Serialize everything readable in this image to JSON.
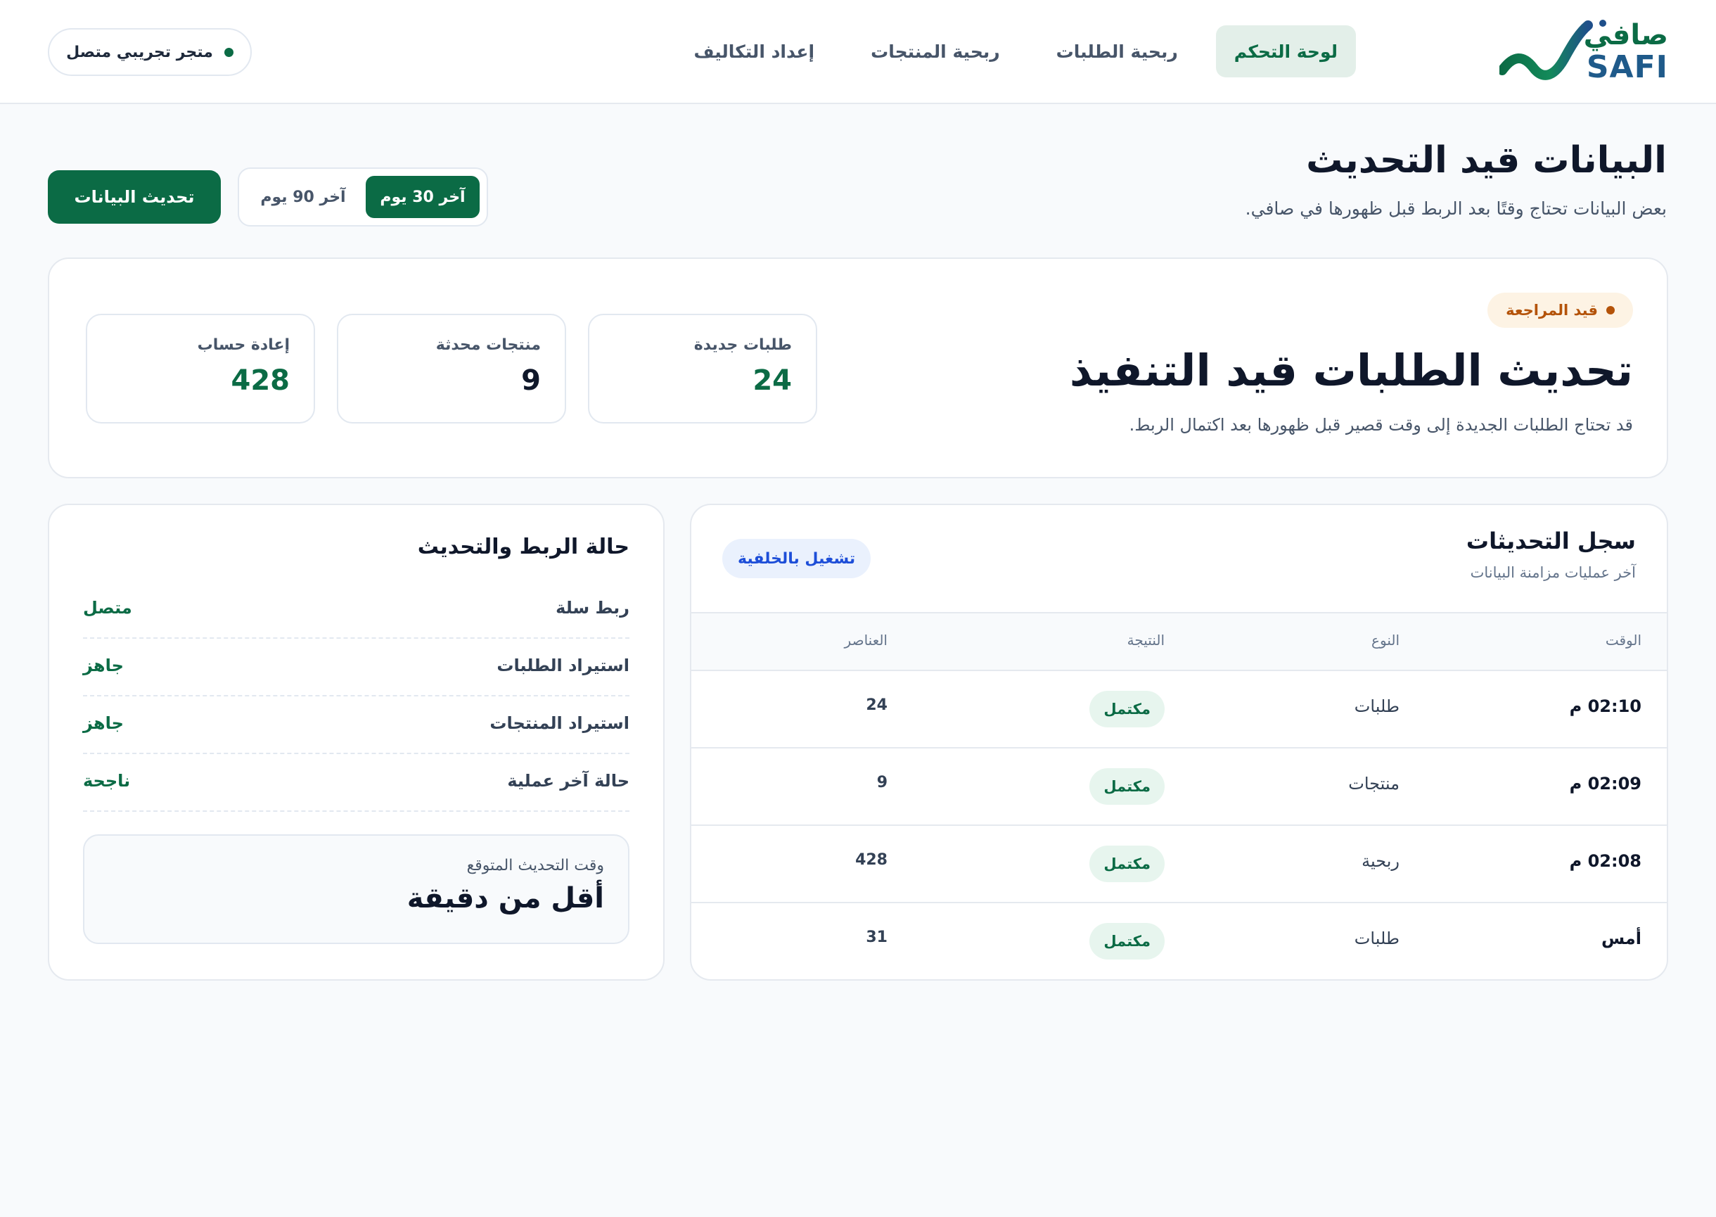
{
  "brand": {
    "name_ar": "صافي",
    "name_en": "SAFI"
  },
  "nav": {
    "items": [
      {
        "label": "لوحة التحكم",
        "active": true
      },
      {
        "label": "ربحية الطلبات",
        "active": false
      },
      {
        "label": "ربحية المنتجات",
        "active": false
      },
      {
        "label": "إعداد التكاليف",
        "active": false
      }
    ]
  },
  "store_status": {
    "label": "متجر تجريبي متصل"
  },
  "page": {
    "title": "البيانات قيد التحديث",
    "subtitle": "بعض البيانات تحتاج وقتًا بعد الربط قبل ظهورها في صافي.",
    "refresh_label": "تحديث البيانات",
    "ranges": [
      {
        "label": "آخر 30 يوم",
        "active": true
      },
      {
        "label": "آخر 90 يوم",
        "active": false
      }
    ]
  },
  "hero": {
    "badge": "قيد المراجعة",
    "title": "تحديث الطلبات قيد التنفيذ",
    "subtitle": "قد تحتاج الطلبات الجديدة إلى وقت قصير قبل ظهورها بعد اكتمال الربط.",
    "stats": [
      {
        "label": "طلبات جديدة",
        "value": "24"
      },
      {
        "label": "منتجات محدثة",
        "value": "9"
      },
      {
        "label": "إعادة حساب",
        "value": "428"
      }
    ]
  },
  "log": {
    "title": "سجل التحديثات",
    "subtitle": "آخر عمليات مزامنة البيانات",
    "badge": "تشغيل بالخلفية",
    "columns": {
      "time": "الوقت",
      "type": "النوع",
      "result": "النتيجة",
      "items": "العناصر"
    },
    "rows": [
      {
        "time": "02:10 م",
        "type": "طلبات",
        "result": "مكتمل",
        "items": "24"
      },
      {
        "time": "02:09 م",
        "type": "منتجات",
        "result": "مكتمل",
        "items": "9"
      },
      {
        "time": "02:08 م",
        "type": "ربحية",
        "result": "مكتمل",
        "items": "428"
      },
      {
        "time": "أمس",
        "type": "طلبات",
        "result": "مكتمل",
        "items": "31"
      }
    ]
  },
  "status": {
    "title": "حالة الربط والتحديث",
    "rows": [
      {
        "label": "ربط سلة",
        "value": "متصل"
      },
      {
        "label": "استيراد الطلبات",
        "value": "جاهز"
      },
      {
        "label": "استيراد المنتجات",
        "value": "جاهز"
      },
      {
        "label": "حالة آخر عملية",
        "value": "ناجحة"
      }
    ],
    "eta_label": "وقت التحديث المتوقع",
    "eta_value": "أقل من دقيقة"
  },
  "colors": {
    "primary": "#0b6b45",
    "active_nav_bg": "#e3efe9",
    "warning": "#b45309",
    "info": "#1d4ed8",
    "success_bg": "#e7f5ee"
  },
  "icons": {
    "logo": "safi-wave-logo",
    "status_dot": "status-dot-icon"
  }
}
